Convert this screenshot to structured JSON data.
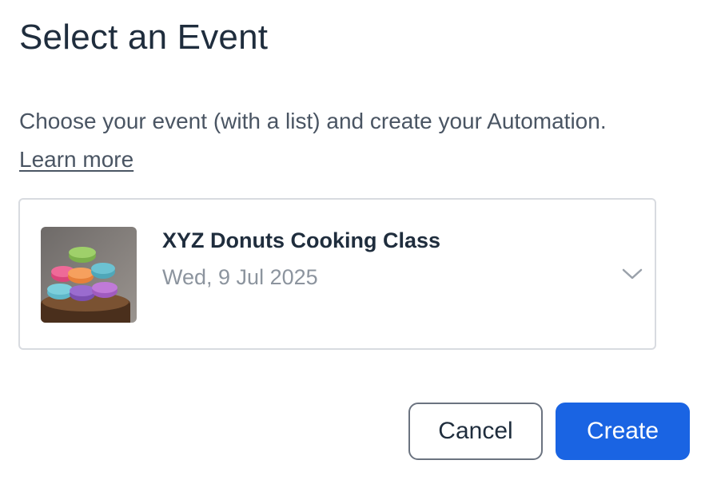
{
  "dialog": {
    "title": "Select an Event",
    "description": "Choose your event (with a list) and create your Automation.",
    "learn_more": "Learn more"
  },
  "event": {
    "name": "XYZ Donuts Cooking Class",
    "date": "Wed, 9 Jul 2025",
    "thumbnail_icon": "macarons-photo",
    "dropdown_icon": "chevron-down-icon"
  },
  "actions": {
    "cancel_label": "Cancel",
    "create_label": "Create"
  },
  "colors": {
    "primary": "#1a64e3",
    "title_text": "#1f2d3d",
    "muted_text": "#8c949e",
    "border": "#d8dbe0"
  }
}
